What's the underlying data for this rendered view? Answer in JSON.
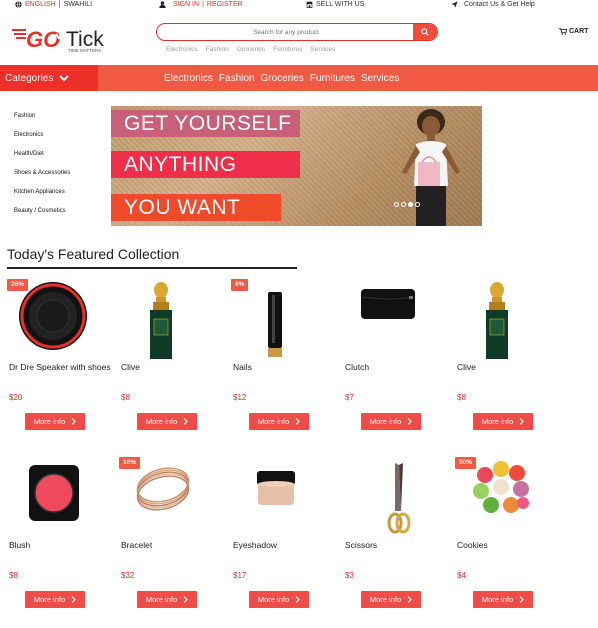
{
  "topbar": {
    "lang_english": "ENGLISH",
    "sep": "|",
    "lang_swahili": "SWAHILI",
    "signin": "SIGN IN",
    "register": "REGISTER",
    "sell": "SELL WITH US",
    "contact": "Contact Us & Get Help"
  },
  "header": {
    "logo_text": "Tick",
    "logo_prefix": "GO",
    "logo_tagline": "TIME MATTERS",
    "search_placeholder": "Search for any product",
    "quick_links": [
      "Electronics",
      "Fashion",
      "Groceries",
      "Furnitures",
      "Services"
    ],
    "cart_label": "CART"
  },
  "nav": {
    "categories_label": "Categories",
    "links": [
      "Electronics",
      "Fashion",
      "Groceries",
      "Furnitures",
      "Services"
    ]
  },
  "sidebar": {
    "items": [
      "Fashion",
      "Electronics",
      "Health/Diet",
      "Shoes & Accessories",
      "Kitchen Appliances",
      "Beauty / Cosmetics"
    ]
  },
  "banner": {
    "line1": "GET YOURSELF",
    "line2": "ANYTHING",
    "line3": "YOU WANT",
    "slides": 4,
    "active_slide": 3
  },
  "featured": {
    "title": "Today's Featured Collection",
    "more_label": "More info",
    "products": [
      {
        "name": "Dr Dre Speaker with shoes",
        "price": "$20",
        "badge": "26%",
        "icon": "speaker-icon"
      },
      {
        "name": "Clive",
        "price": "$8",
        "badge": "",
        "icon": "perfume-icon"
      },
      {
        "name": "Nails",
        "price": "$12",
        "badge": "6%",
        "icon": "nail-polish-icon"
      },
      {
        "name": "Clutch",
        "price": "$7",
        "badge": "",
        "icon": "clutch-icon"
      },
      {
        "name": "Clive",
        "price": "$8",
        "badge": "",
        "icon": "perfume-icon"
      },
      {
        "name": "Blush",
        "price": "$8",
        "badge": "",
        "icon": "blush-icon"
      },
      {
        "name": "Bracelet",
        "price": "$32",
        "badge": "16%",
        "icon": "bracelet-icon"
      },
      {
        "name": "Eyeshadow",
        "price": "$17",
        "badge": "",
        "icon": "eyeshadow-icon"
      },
      {
        "name": "Scissors",
        "price": "$3",
        "badge": "",
        "icon": "scissors-icon"
      },
      {
        "name": "Cookies",
        "price": "$4",
        "badge": "50%",
        "icon": "macarons-icon"
      }
    ]
  },
  "colors": {
    "accent": "#f05a44",
    "accent_dark": "#ef2f2a",
    "price": "#e8302a"
  }
}
